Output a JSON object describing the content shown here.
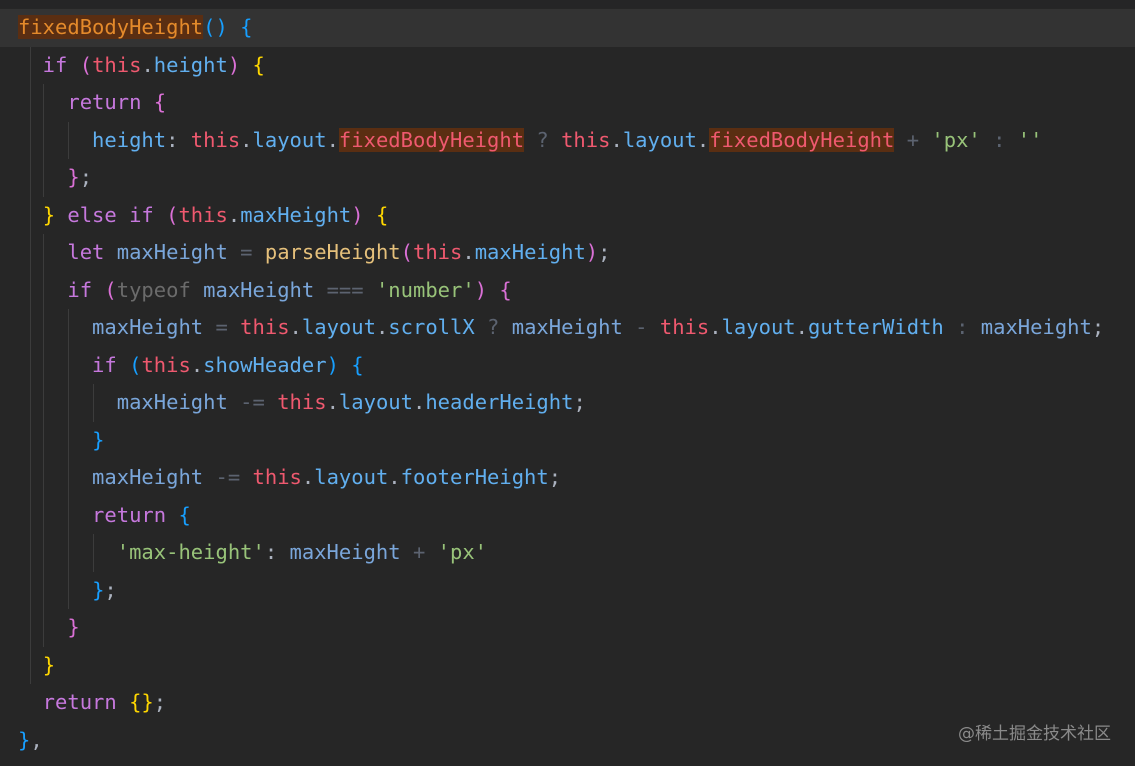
{
  "editor": {
    "lines": [
      [
        {
          "t": "fixedBodyHeight",
          "c": "fo",
          "h": "hl"
        },
        {
          "t": "()",
          "c": "p3"
        },
        {
          "t": " "
        },
        {
          "t": "{",
          "c": "p3"
        }
      ],
      [
        {
          "t": "  if ",
          "c": "kw2"
        },
        {
          "t": "(",
          "c": "p2"
        },
        {
          "t": "this",
          "c": "th"
        },
        {
          "t": ".",
          "c": "df"
        },
        {
          "t": "height",
          "c": "pr"
        },
        {
          "t": ")",
          "c": "p2"
        },
        {
          "t": " "
        },
        {
          "t": "{",
          "c": "p1"
        }
      ],
      [
        {
          "t": "    return ",
          "c": "kw2"
        },
        {
          "t": "{",
          "c": "p2"
        }
      ],
      [
        {
          "t": "      height",
          "c": "pr"
        },
        {
          "t": ": ",
          "c": "df"
        },
        {
          "t": "this",
          "c": "th"
        },
        {
          "t": ".",
          "c": "df"
        },
        {
          "t": "layout",
          "c": "pr"
        },
        {
          "t": ".",
          "c": "df"
        },
        {
          "t": "fixedBodyHeight",
          "c": "th",
          "h": "hl"
        },
        {
          "t": " ? ",
          "c": "op"
        },
        {
          "t": "this",
          "c": "th"
        },
        {
          "t": ".",
          "c": "df"
        },
        {
          "t": "layout",
          "c": "pr"
        },
        {
          "t": ".",
          "c": "df"
        },
        {
          "t": "fixedBodyHeight",
          "c": "th",
          "h": "hl"
        },
        {
          "t": " + ",
          "c": "op"
        },
        {
          "t": "'px'",
          "c": "st"
        },
        {
          "t": " : ",
          "c": "op"
        },
        {
          "t": "''",
          "c": "st"
        }
      ],
      [
        {
          "t": "    ",
          "c": "df"
        },
        {
          "t": "}",
          "c": "p2"
        },
        {
          "t": ";",
          "c": "df"
        }
      ],
      [
        {
          "t": "  ",
          "c": "df"
        },
        {
          "t": "}",
          "c": "p1"
        },
        {
          "t": " else if ",
          "c": "kw2"
        },
        {
          "t": "(",
          "c": "p2"
        },
        {
          "t": "this",
          "c": "th"
        },
        {
          "t": ".",
          "c": "df"
        },
        {
          "t": "maxHeight",
          "c": "pr"
        },
        {
          "t": ")",
          "c": "p2"
        },
        {
          "t": " "
        },
        {
          "t": "{",
          "c": "p1"
        }
      ],
      [
        {
          "t": "    let ",
          "c": "kw2"
        },
        {
          "t": "maxHeight",
          "c": "vr"
        },
        {
          "t": " = ",
          "c": "op"
        },
        {
          "t": "parseHeight",
          "c": "cfn"
        },
        {
          "t": "(",
          "c": "p2"
        },
        {
          "t": "this",
          "c": "th"
        },
        {
          "t": ".",
          "c": "df"
        },
        {
          "t": "maxHeight",
          "c": "pr"
        },
        {
          "t": ")",
          "c": "p2"
        },
        {
          "t": ";",
          "c": "df"
        }
      ],
      [
        {
          "t": "    if ",
          "c": "kw2"
        },
        {
          "t": "(",
          "c": "p2"
        },
        {
          "t": "typeof ",
          "c": "dim"
        },
        {
          "t": "maxHeight",
          "c": "vr"
        },
        {
          "t": " === ",
          "c": "op"
        },
        {
          "t": "'number'",
          "c": "st"
        },
        {
          "t": ")",
          "c": "p2"
        },
        {
          "t": " "
        },
        {
          "t": "{",
          "c": "p2"
        }
      ],
      [
        {
          "t": "      maxHeight",
          "c": "vr"
        },
        {
          "t": " = ",
          "c": "op"
        },
        {
          "t": "this",
          "c": "th"
        },
        {
          "t": ".",
          "c": "df"
        },
        {
          "t": "layout",
          "c": "pr"
        },
        {
          "t": ".",
          "c": "df"
        },
        {
          "t": "scrollX",
          "c": "pr"
        },
        {
          "t": " ? ",
          "c": "op"
        },
        {
          "t": "maxHeight",
          "c": "vr"
        },
        {
          "t": " - ",
          "c": "op"
        },
        {
          "t": "this",
          "c": "th"
        },
        {
          "t": ".",
          "c": "df"
        },
        {
          "t": "layout",
          "c": "pr"
        },
        {
          "t": ".",
          "c": "df"
        },
        {
          "t": "gutterWidth",
          "c": "pr"
        },
        {
          "t": " : ",
          "c": "op"
        },
        {
          "t": "maxHeight",
          "c": "vr"
        },
        {
          "t": ";",
          "c": "df"
        }
      ],
      [
        {
          "t": "      if ",
          "c": "kw2"
        },
        {
          "t": "(",
          "c": "p3"
        },
        {
          "t": "this",
          "c": "th"
        },
        {
          "t": ".",
          "c": "df"
        },
        {
          "t": "showHeader",
          "c": "pr"
        },
        {
          "t": ")",
          "c": "p3"
        },
        {
          "t": " "
        },
        {
          "t": "{",
          "c": "p3"
        }
      ],
      [
        {
          "t": "        maxHeight",
          "c": "vr"
        },
        {
          "t": " -= ",
          "c": "op"
        },
        {
          "t": "this",
          "c": "th"
        },
        {
          "t": ".",
          "c": "df"
        },
        {
          "t": "layout",
          "c": "pr"
        },
        {
          "t": ".",
          "c": "df"
        },
        {
          "t": "headerHeight",
          "c": "pr"
        },
        {
          "t": ";",
          "c": "df"
        }
      ],
      [
        {
          "t": "      ",
          "c": "df"
        },
        {
          "t": "}",
          "c": "p3"
        }
      ],
      [
        {
          "t": "      maxHeight",
          "c": "vr"
        },
        {
          "t": " -= ",
          "c": "op"
        },
        {
          "t": "this",
          "c": "th"
        },
        {
          "t": ".",
          "c": "df"
        },
        {
          "t": "layout",
          "c": "pr"
        },
        {
          "t": ".",
          "c": "df"
        },
        {
          "t": "footerHeight",
          "c": "pr"
        },
        {
          "t": ";",
          "c": "df"
        }
      ],
      [
        {
          "t": "      return ",
          "c": "kw2"
        },
        {
          "t": "{",
          "c": "p3"
        }
      ],
      [
        {
          "t": "        'max-height'",
          "c": "st"
        },
        {
          "t": ": ",
          "c": "df"
        },
        {
          "t": "maxHeight",
          "c": "vr"
        },
        {
          "t": " + ",
          "c": "op"
        },
        {
          "t": "'px'",
          "c": "st"
        }
      ],
      [
        {
          "t": "      ",
          "c": "df"
        },
        {
          "t": "}",
          "c": "p3"
        },
        {
          "t": ";",
          "c": "df"
        }
      ],
      [
        {
          "t": "    ",
          "c": "df"
        },
        {
          "t": "}",
          "c": "p2"
        }
      ],
      [
        {
          "t": "  ",
          "c": "df"
        },
        {
          "t": "}",
          "c": "p1"
        }
      ],
      [
        {
          "t": "  return ",
          "c": "kw2"
        },
        {
          "t": "{}",
          "c": "p1"
        },
        {
          "t": ";",
          "c": "df"
        }
      ],
      [
        {
          "t": "}",
          "c": "p3"
        },
        {
          "t": ",",
          "c": "df"
        }
      ]
    ],
    "current_line": 0
  },
  "watermark": "@稀土掘金技术社区"
}
